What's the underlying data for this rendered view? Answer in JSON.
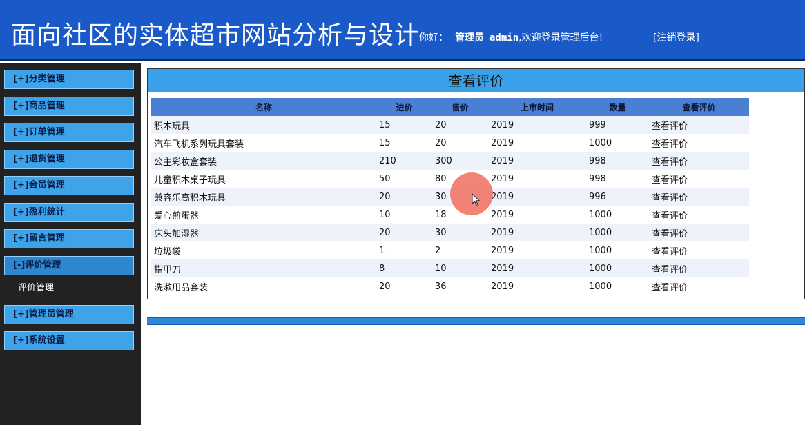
{
  "header": {
    "title": "面向社区的实体超市网站分析与设计",
    "greeting_label": "你好：",
    "role": "管理员",
    "username": "admin",
    "welcome": ",欢迎登录管理后台!",
    "logout": "[注销登录]"
  },
  "sidebar": {
    "items": [
      {
        "label": "[+]分类管理"
      },
      {
        "label": "[+]商品管理"
      },
      {
        "label": "[+]订单管理"
      },
      {
        "label": "[+]退货管理"
      },
      {
        "label": "[+]会员管理"
      },
      {
        "label": "[+]盈利统计"
      },
      {
        "label": "[+]留言管理"
      },
      {
        "label": "[-]评价管理"
      },
      {
        "label": "[+]管理员管理"
      },
      {
        "label": "[+]系统设置"
      }
    ],
    "subitem": "评价管理"
  },
  "panel": {
    "title": "查看评价",
    "columns": [
      "名称",
      "进价",
      "售价",
      "上市时间",
      "数量",
      "查看评价"
    ],
    "rows": [
      {
        "name": "积木玩具",
        "cost": "15",
        "price": "20",
        "date": "2019",
        "qty": "999",
        "action": "查看评价"
      },
      {
        "name": "汽车飞机系列玩具套装",
        "cost": "15",
        "price": "20",
        "date": "2019",
        "qty": "1000",
        "action": "查看评价"
      },
      {
        "name": "公主彩妆盒套装",
        "cost": "210",
        "price": "300",
        "date": "2019",
        "qty": "998",
        "action": "查看评价"
      },
      {
        "name": "儿童积木桌子玩具",
        "cost": "50",
        "price": "80",
        "date": "2019",
        "qty": "998",
        "action": "查看评价"
      },
      {
        "name": "兼容乐高积木玩具",
        "cost": "20",
        "price": "30",
        "date": "2019",
        "qty": "996",
        "action": "查看评价"
      },
      {
        "name": "爱心煎蛋器",
        "cost": "10",
        "price": "18",
        "date": "2019",
        "qty": "1000",
        "action": "查看评价"
      },
      {
        "name": "床头加湿器",
        "cost": "20",
        "price": "30",
        "date": "2019",
        "qty": "1000",
        "action": "查看评价"
      },
      {
        "name": "垃圾袋",
        "cost": "1",
        "price": "2",
        "date": "2019",
        "qty": "1000",
        "action": "查看评价"
      },
      {
        "name": "指甲刀",
        "cost": "8",
        "price": "10",
        "date": "2019",
        "qty": "1000",
        "action": "查看评价"
      },
      {
        "name": "洗漱用品套装",
        "cost": "20",
        "price": "36",
        "date": "2019",
        "qty": "1000",
        "action": "查看评价"
      }
    ]
  },
  "colors": {
    "header_bg": "#1a5ac8",
    "menu_bg": "#3ea3e8",
    "sidebar_bg": "#222222",
    "table_header_bg": "#4a7fd4",
    "cursor_highlight": "#f06e5f"
  }
}
